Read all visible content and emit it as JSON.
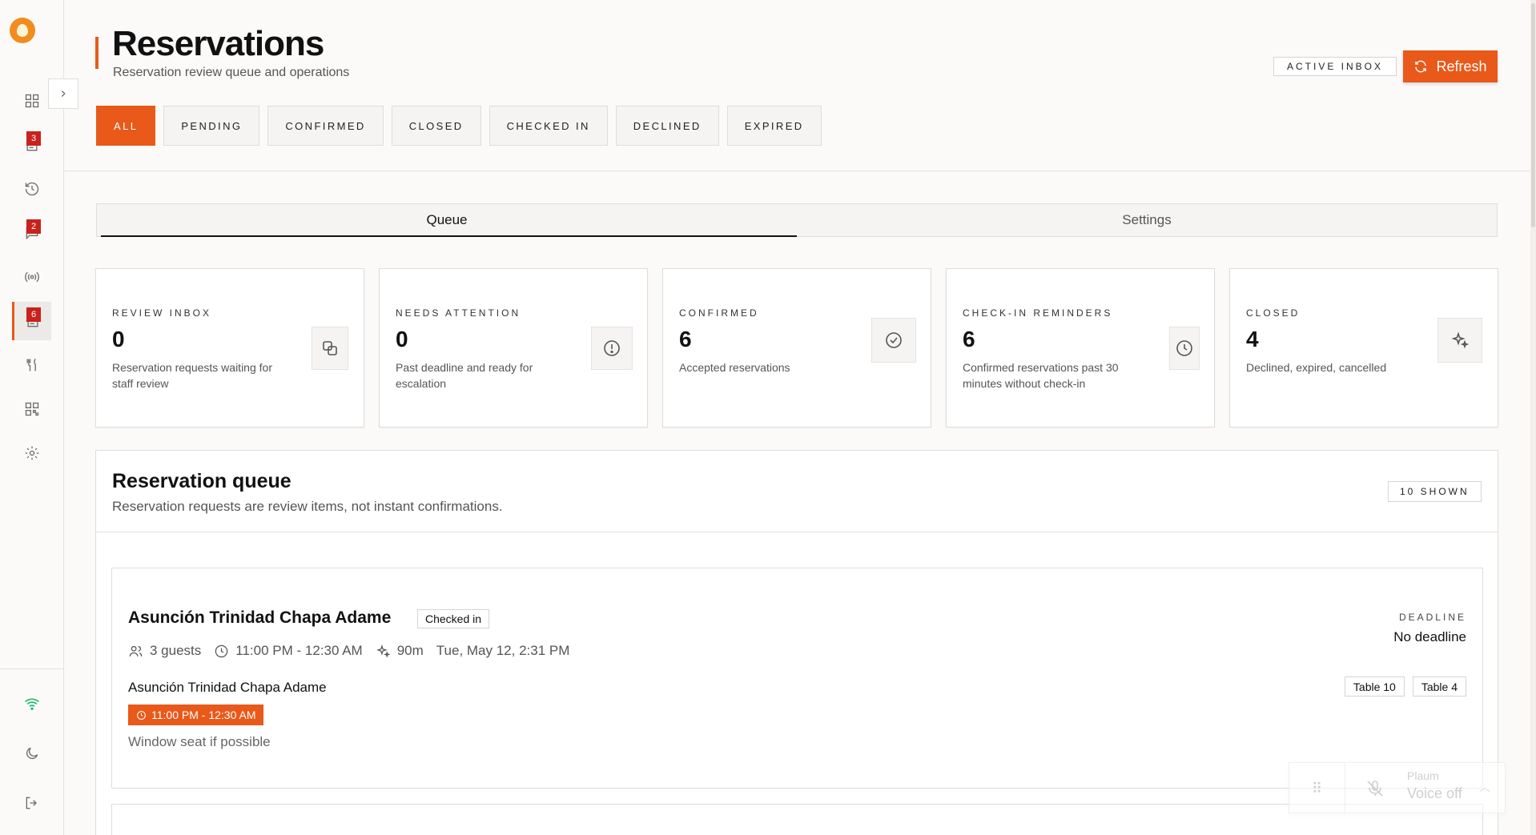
{
  "sidebar": {
    "badges": {
      "requests": "3",
      "messages": "2",
      "reservations": "6"
    }
  },
  "header": {
    "title": "Reservations",
    "subtitle": "Reservation review queue and operations",
    "active_inbox": "ACTIVE INBOX",
    "refresh_label": "Refresh"
  },
  "filters": [
    "ALL",
    "PENDING",
    "CONFIRMED",
    "CLOSED",
    "CHECKED IN",
    "DECLINED",
    "EXPIRED"
  ],
  "tabs": {
    "queue": "Queue",
    "settings": "Settings"
  },
  "stats": [
    {
      "label": "REVIEW INBOX",
      "value": "0",
      "desc": "Reservation requests waiting for staff review",
      "icon": "copy-icon"
    },
    {
      "label": "NEEDS ATTENTION",
      "value": "0",
      "desc": "Past deadline and ready for escalation",
      "icon": "alert-circle-icon"
    },
    {
      "label": "CONFIRMED",
      "value": "6",
      "desc": "Accepted reservations",
      "icon": "check-circle-icon"
    },
    {
      "label": "CHECK-IN REMINDERS",
      "value": "6",
      "desc": "Confirmed reservations past 30 minutes without check-in",
      "icon": "clock-icon"
    },
    {
      "label": "CLOSED",
      "value": "4",
      "desc": "Declined, expired, cancelled",
      "icon": "sparkles-icon"
    }
  ],
  "queue": {
    "title": "Reservation queue",
    "subtitle": "Reservation requests are review items, not instant confirmations.",
    "shown": "10 SHOWN",
    "reservations": [
      {
        "name": "Asunción Trinidad Chapa Adame",
        "status": "Checked in",
        "guests": "3 guests",
        "time": "11:00 PM - 12:30 AM",
        "duration": "90m",
        "created": "Tue, May 12, 2:31 PM",
        "deadline_label": "DEADLINE",
        "deadline": "No deadline",
        "guest_name": "Asunción Trinidad Chapa Adame",
        "time_chip": "11:00 PM - 12:30 AM",
        "note": "Window seat if possible",
        "tables": [
          "Table 10",
          "Table 4"
        ]
      }
    ]
  },
  "voice": {
    "name": "Plaum",
    "status": "Voice off"
  },
  "colors": {
    "accent": "#e8591a",
    "badge": "#c8221c",
    "online": "#1fb86b"
  }
}
